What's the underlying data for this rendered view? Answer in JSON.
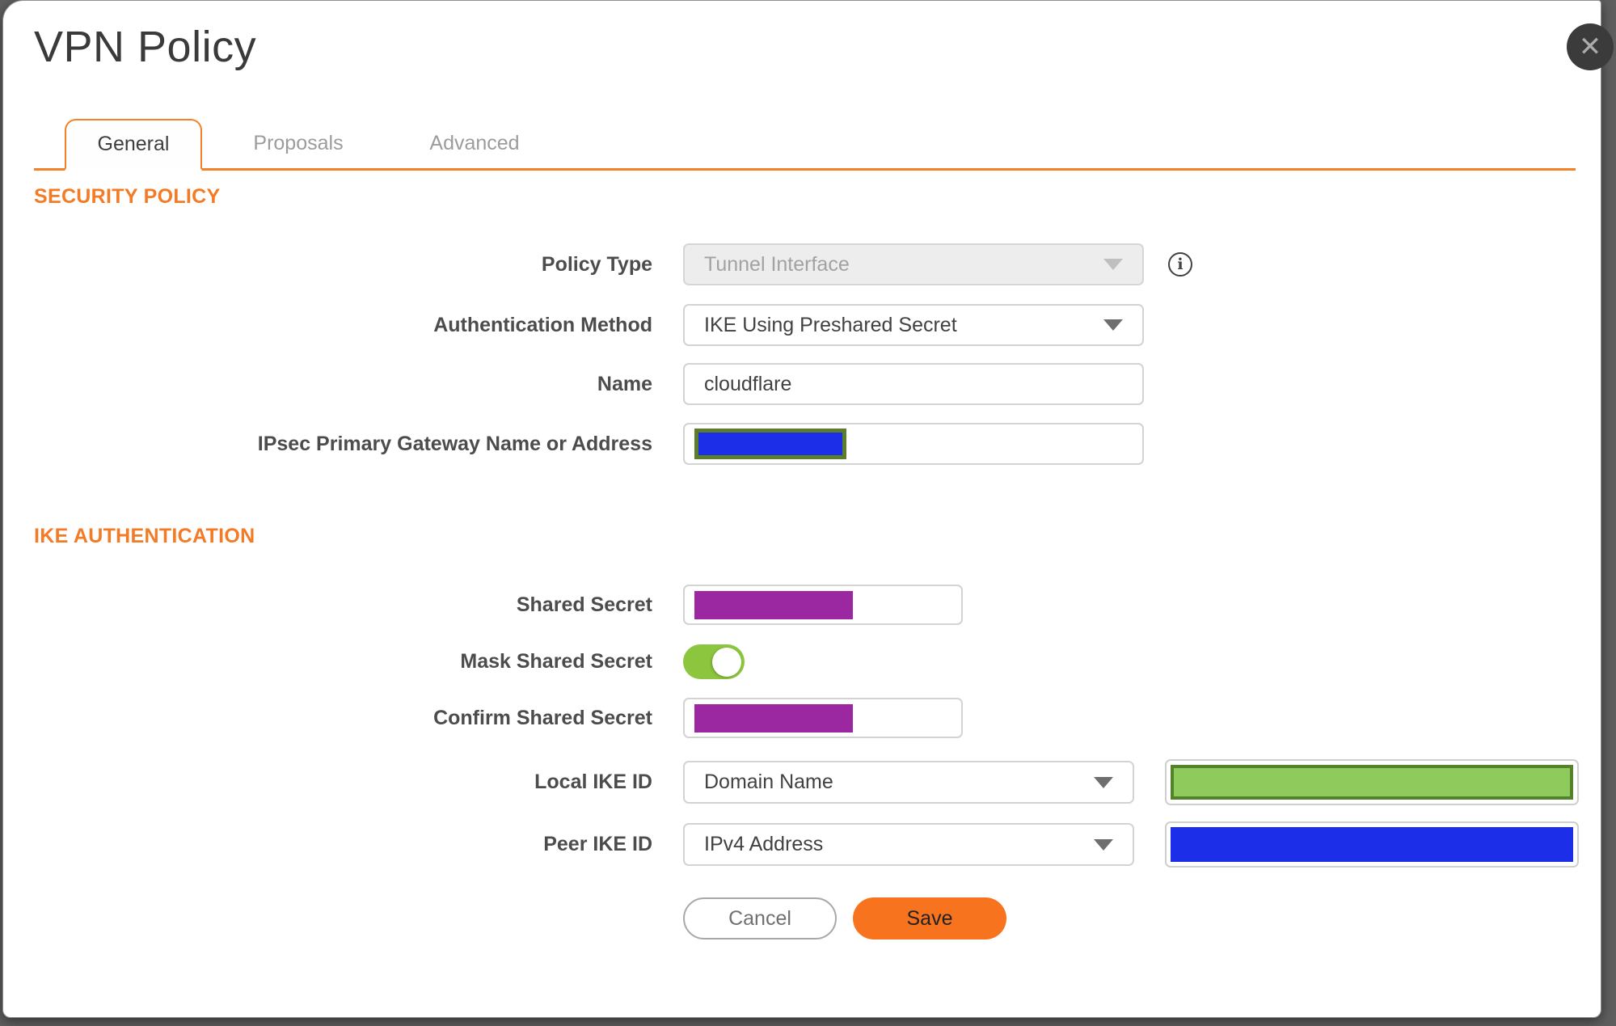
{
  "dialog": {
    "title": "VPN Policy"
  },
  "icons": {
    "close_glyph": "✕",
    "info_glyph": "i"
  },
  "tabs": [
    {
      "label": "General",
      "active": true
    },
    {
      "label": "Proposals",
      "active": false
    },
    {
      "label": "Advanced",
      "active": false
    }
  ],
  "sections": [
    {
      "heading": "SECURITY POLICY"
    },
    {
      "heading": "IKE AUTHENTICATION"
    }
  ],
  "fields": {
    "policy_type": {
      "label": "Policy Type",
      "value": "Tunnel Interface",
      "disabled": true
    },
    "authentication_method": {
      "label": "Authentication Method",
      "value": "IKE Using Preshared Secret"
    },
    "name": {
      "label": "Name",
      "value": "cloudflare"
    },
    "ipsec_gateway": {
      "label": "IPsec Primary Gateway Name or Address",
      "value": "",
      "value_masked": true
    },
    "shared_secret": {
      "label": "Shared Secret",
      "value": "",
      "value_masked": true
    },
    "mask_shared_secret": {
      "label": "Mask Shared Secret",
      "state": "on"
    },
    "confirm_shared_secret": {
      "label": "Confirm Shared Secret",
      "value": "",
      "value_masked": true
    },
    "local_ike_id": {
      "label": "Local IKE ID",
      "value": "Domain Name",
      "id_value": "",
      "id_value_masked": true
    },
    "peer_ike_id": {
      "label": "Peer IKE ID",
      "value": "IPv4 Address",
      "id_value": "",
      "id_value_masked": true
    }
  },
  "buttons": {
    "cancel": "Cancel",
    "save": "Save"
  },
  "colors": {
    "accent_orange": "#F58025",
    "section_heading_orange": "#F47B25",
    "save_button_orange": "#F7731E",
    "toggle_on_green": "#8CC63E",
    "mask_blue": "#1D2EE8",
    "mask_purple": "#9C28A1",
    "mask_green_fill": "#8ECB5C",
    "mask_green_border": "#53822A",
    "mask_gateway_border_olive": "#5C7E2B"
  }
}
